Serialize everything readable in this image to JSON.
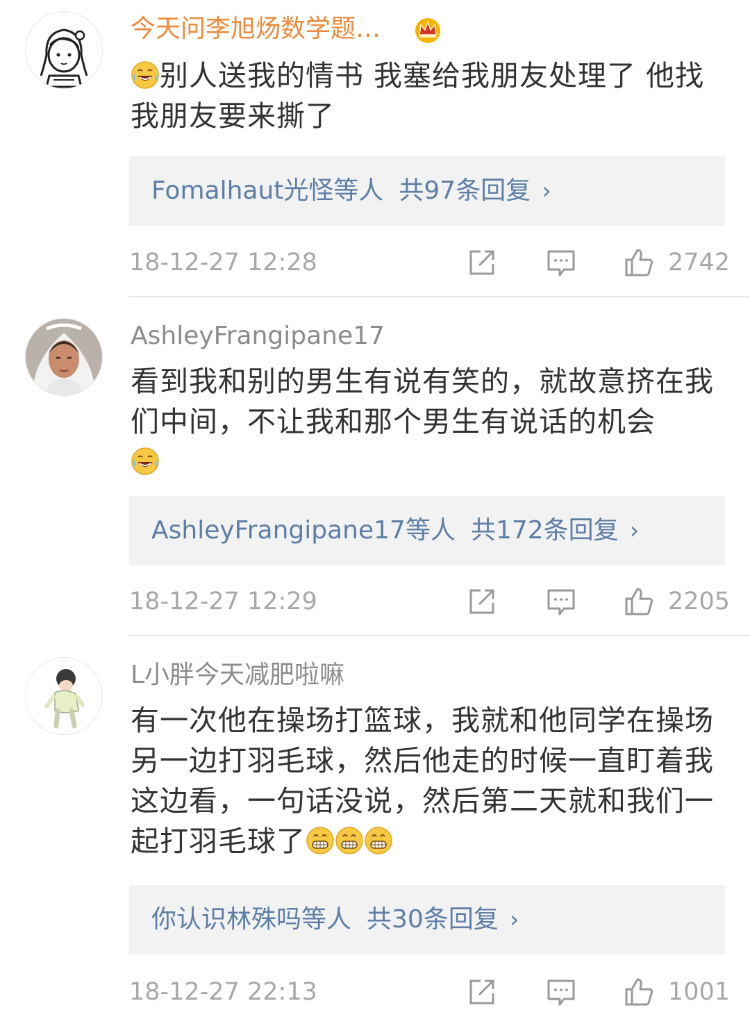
{
  "comments": [
    {
      "username": "今天问李旭炀数学题…",
      "vip_badge": "crown-icon",
      "content_emoji_lead": "laughing-crying-emoji",
      "content": "别人送我的情书 我塞给我朋友处理了 他找我朋友要来撕了",
      "reply_summary": {
        "names": "Fomalhaut光怪等人",
        "count_text": "共97条回复",
        "chevron": "›"
      },
      "timestamp": "18-12-27 12:28",
      "likes": "2742"
    },
    {
      "username": "AshleyFrangipane17",
      "content": "看到我和别的男生有说有笑的，就故意挤在我们中间，不让我和那个男生有说话的机会",
      "content_emoji_trail": "laughing-crying-emoji",
      "reply_summary": {
        "names": "AshleyFrangipane17等人",
        "count_text": "共172条回复",
        "chevron": "›"
      },
      "timestamp": "18-12-27 12:29",
      "likes": "2205"
    },
    {
      "username": "L小胖今天减肥啦嘛",
      "content": "有一次他在操场打篮球，我就和他同学在操场另一边打羽毛球，然后他走的时候一直盯着我这边看，一句话没说，然后第二天就和我们一起打羽毛球了",
      "content_emoji_trail": "grinning-emoji",
      "reply_summary": {
        "names": "你认识林殊吗等人",
        "count_text": "共30条回复",
        "chevron": "›"
      },
      "timestamp": "18-12-27 22:13",
      "likes": "1001"
    }
  ],
  "icons": {
    "share": "share-icon",
    "comment": "comment-icon",
    "like": "thumbs-up-icon"
  },
  "colors": {
    "username_vip": "#ec8a3b",
    "username": "#8c8c8c",
    "reply_link": "#5d7ea6",
    "meta_text": "#a8a8a8",
    "reply_bg": "#f2f2f2"
  }
}
